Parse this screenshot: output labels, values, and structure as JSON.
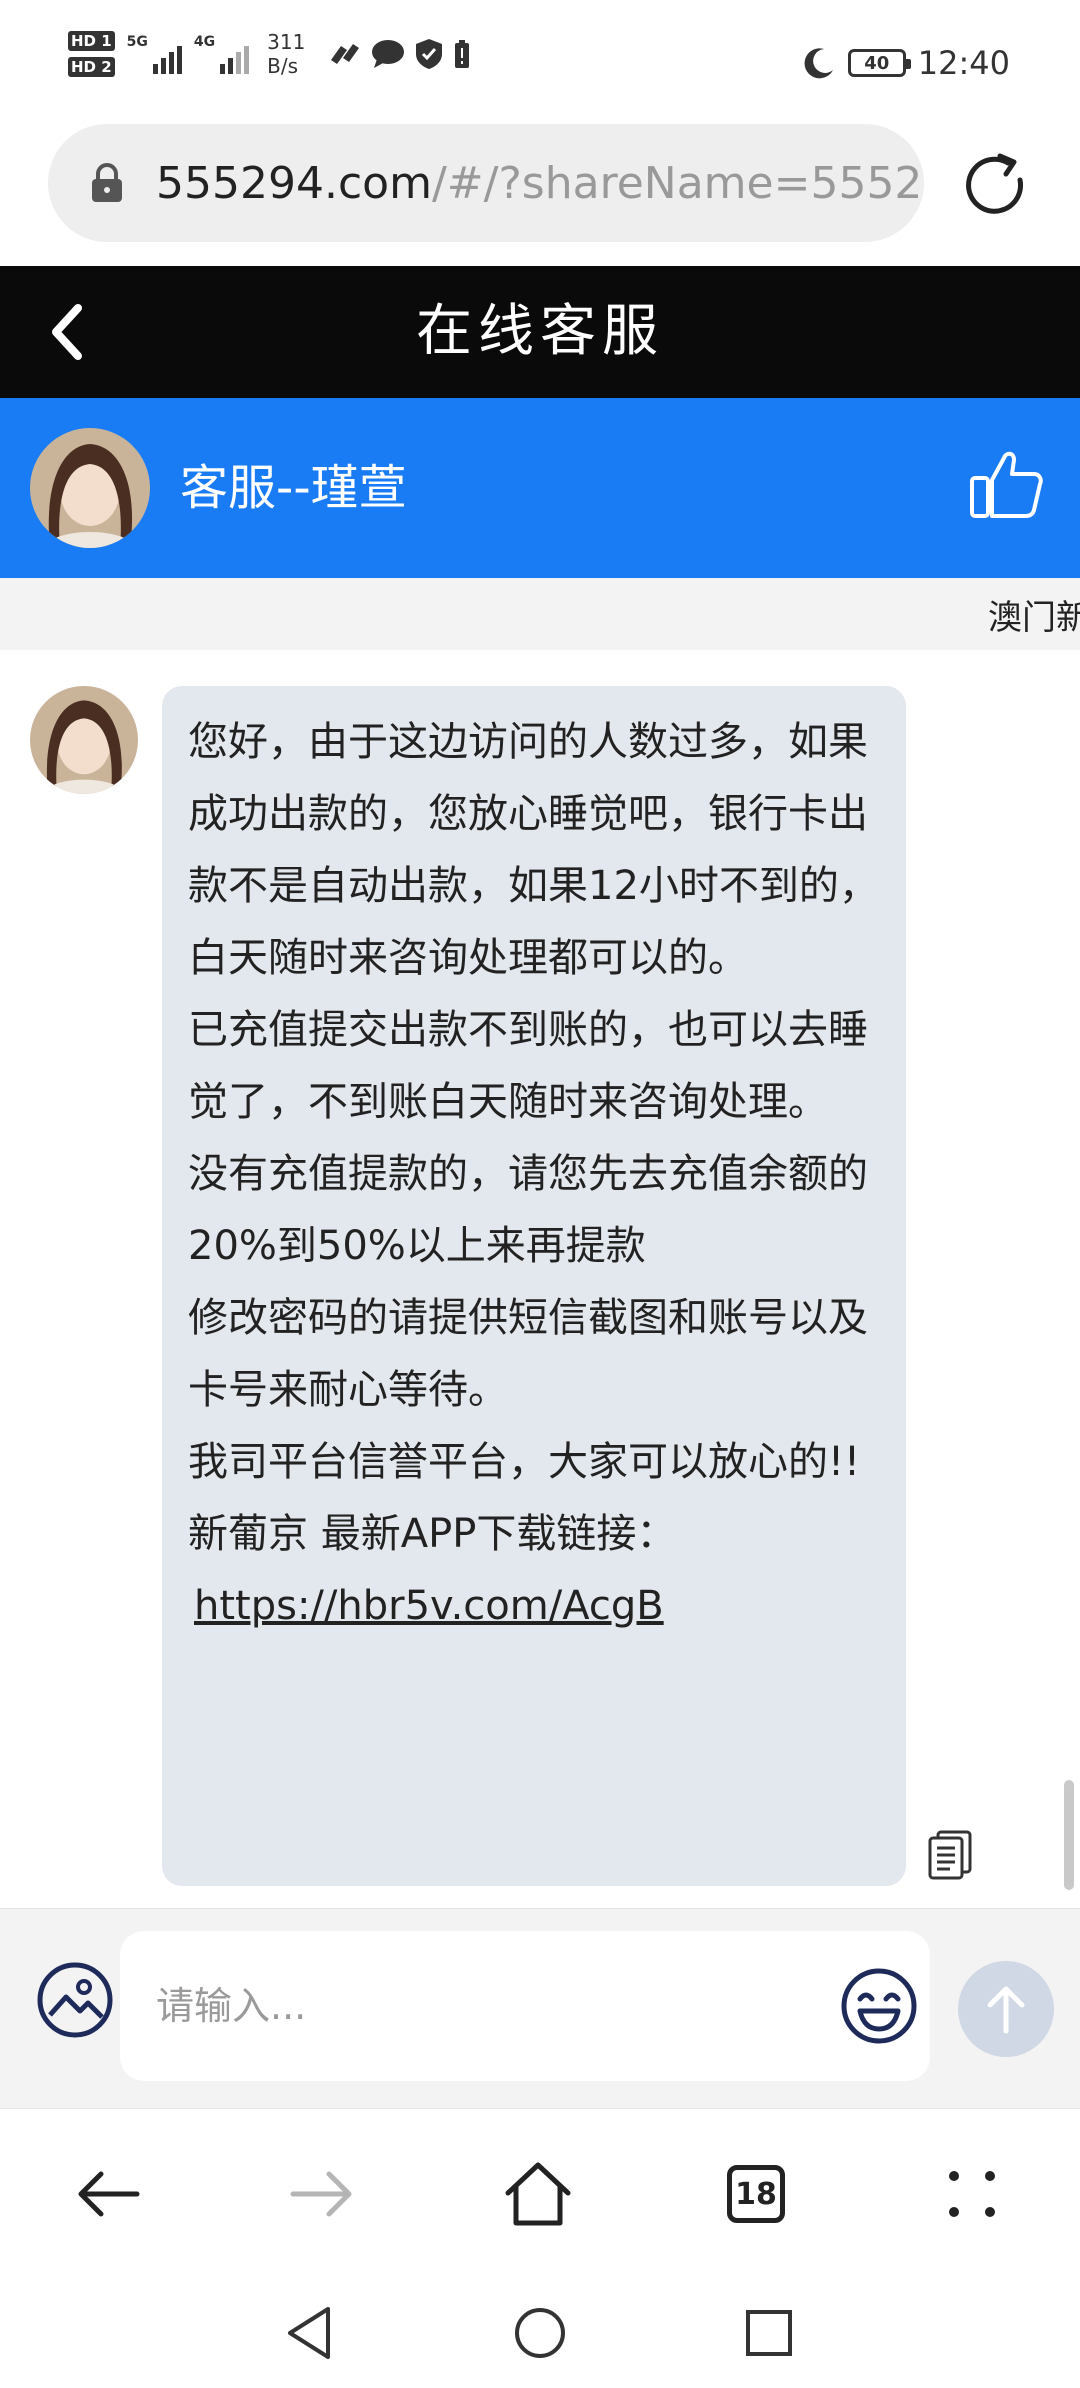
{
  "status_bar": {
    "sim1_label": "HD 1",
    "sim2_label": "HD 2",
    "net1_label": "5G",
    "net2_label": "4G",
    "net_speed_value": "311",
    "net_speed_unit": "B/s",
    "battery": "40",
    "time": "12:40"
  },
  "address_bar": {
    "domain": "555294.com",
    "path": "/#/?shareName=5552"
  },
  "header": {
    "title": "在线客服"
  },
  "agent": {
    "name": "客服--瑾萱"
  },
  "marquee": {
    "text": "澳门新"
  },
  "message": {
    "paragraphs": [
      "您好，由于这边访问的人数过多，如果成功出款的，您放心睡觉吧，银行卡出款不是自动出款，如果12小时不到的，白天随时来咨询处理都可以的。",
      "已充值提交出款不到账的，也可以去睡觉了，不到账白天随时来咨询处理。",
      "没有充值提款的，请您先去充值余额的20%到50%以上来再提款",
      "修改密码的请提供短信截图和账号以及卡号来耐心等待。",
      "我司平台信誉平台，大家可以放心的!!",
      "新葡京 最新APP下载链接："
    ],
    "link": "https://hbr5v.com/AcgB"
  },
  "input": {
    "placeholder": "请输入..."
  },
  "browser_nav": {
    "tabs_count": "18"
  },
  "colors": {
    "header_bg": "#0a0a0a",
    "agent_bar_bg": "#1a7cf5",
    "bubble_bg": "#e3e8ef",
    "send_button_bg": "#cfd8e4"
  }
}
